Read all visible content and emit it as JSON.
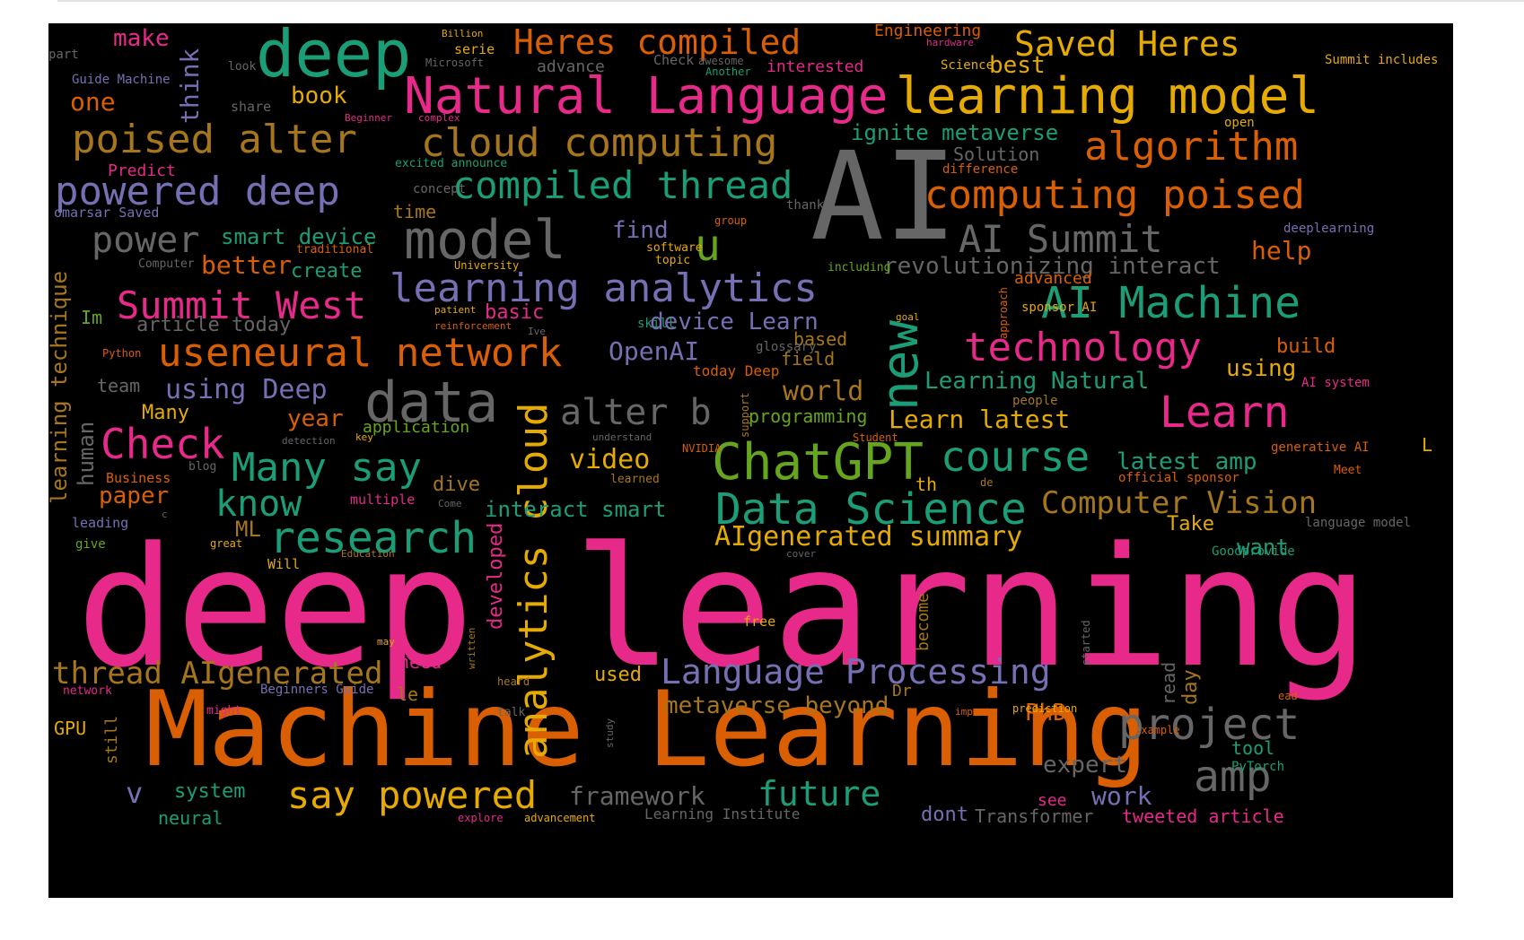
{
  "colors": {
    "pink": "#e7298a",
    "orange": "#d95f02",
    "teal": "#1b9e77",
    "gold": "#e6ab02",
    "purple": "#7570b3",
    "gray": "#666666",
    "green": "#66a61e",
    "brown": "#a6761d"
  },
  "words": [
    "deep learning",
    "Machine Learning",
    "AI",
    "deep",
    "Natural Language",
    "learning model",
    "model",
    "data",
    "ChatGPT",
    "Data Science",
    "research",
    "analytics cloud",
    "new",
    "Heres compiled",
    "Saved Heres",
    "poised alter",
    "cloud computing",
    "algorithm",
    "powered deep",
    "compiled thread",
    "computing poised",
    "AI Summit",
    "power",
    "u",
    "Summit West",
    "learning analytics",
    "AI Machine",
    "useneural network",
    "technology",
    "Check",
    "alter b",
    "Learn",
    "course",
    "Many say",
    "know",
    "project",
    "amp",
    "say powered",
    "future",
    "thread AIgenerated",
    "Language Processing",
    "Computer Vision",
    "AIgenerated summary",
    "framework",
    "make",
    "think",
    "book",
    "one",
    "ignite metaverse",
    "Solution",
    "best",
    "smart device",
    "better",
    "create",
    "find",
    "help",
    "revolutionizing interact",
    "device Learn",
    "OpenAI",
    "using Deep",
    "year",
    "world",
    "Learning Natural",
    "Learn latest",
    "programming",
    "application",
    "video",
    "latest amp",
    "paper",
    "dive",
    "interact smart",
    "ML",
    "Take",
    "want",
    "learning technique",
    "human",
    "article today",
    "Im",
    "basic",
    "team",
    "Many",
    "based",
    "field",
    "today Deep",
    "using",
    "build",
    "developed",
    "metaverse beyond",
    "PhD",
    "expert",
    "v",
    "system",
    "neural",
    "work",
    "dont",
    "Transformer",
    "tweeted article",
    "Learning Institute",
    "tool",
    "read",
    "day",
    "used",
    "need",
    "le",
    "GPU",
    "still",
    "become",
    "Dr",
    "see",
    "th",
    "time",
    "interested",
    "advance",
    "Check",
    "awesome",
    "Another",
    "Science",
    "Engineering",
    "hardware",
    "Billion",
    "serie",
    "Microsoft",
    "part",
    "Guide Machine",
    "look",
    "share",
    "Beginner",
    "complex",
    "open",
    "Summit includes",
    "difference",
    "Predict",
    "excited announce",
    "concept",
    "omarsar Saved",
    "thank",
    "group",
    "deeplearning",
    "traditional",
    "software",
    "topic",
    "University",
    "Computer",
    "including",
    "advanced",
    "sponsor AI",
    "patient",
    "reinforcement",
    "Ive",
    "skill",
    "goal",
    "glossary",
    "approach",
    "Python",
    "support",
    "people",
    "AI system",
    "detection",
    "key",
    "understand",
    "NVIDIA",
    "Student",
    "generative AI",
    "L",
    "Business",
    "blog",
    "learned",
    "official sponsor",
    "Meet",
    "multiple",
    "Come",
    "de",
    "leading",
    "c",
    "language model",
    "give",
    "great",
    "Education",
    "cover",
    "Goodprovide",
    "Will",
    "free",
    "written",
    "may",
    "started",
    "network",
    "Beginners Guide",
    "heard",
    "prediction",
    "ead",
    "might",
    "talk",
    "impact",
    "example",
    "study",
    "PyTorch",
    "explore",
    "advancement"
  ]
}
